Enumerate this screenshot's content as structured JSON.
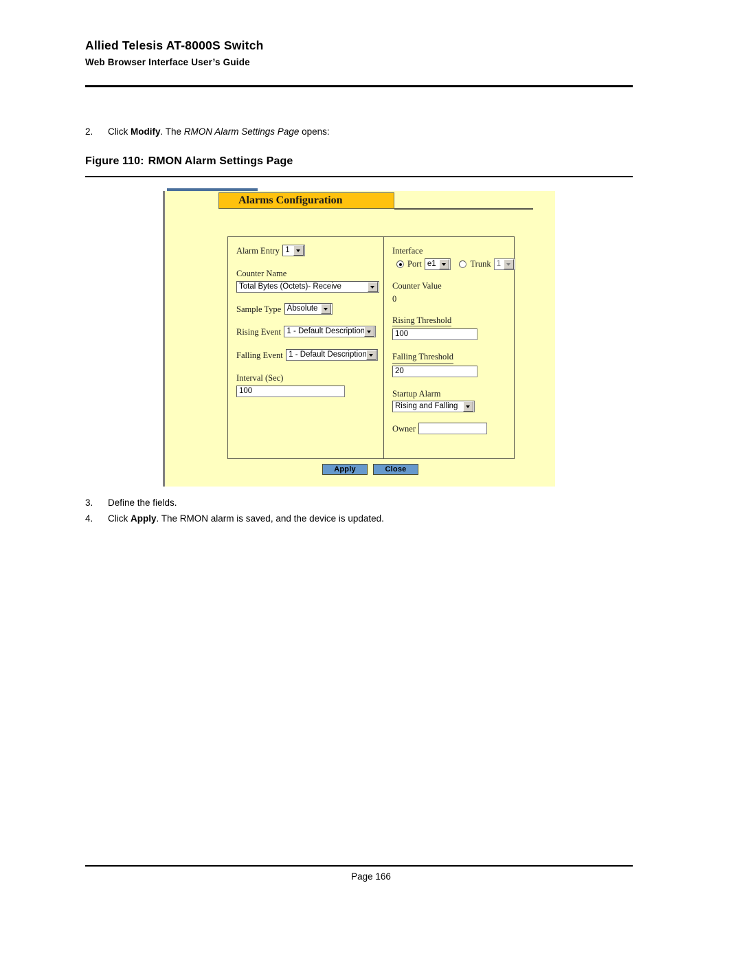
{
  "header": {
    "product_title": "Allied Telesis AT-8000S Switch",
    "guide_title": "Web Browser Interface User’s Guide"
  },
  "steps": {
    "step2": {
      "number": "2.",
      "prefix": "Click ",
      "bold": "Modify",
      "middle": ". The ",
      "italic": "RMON Alarm Settings Page",
      "suffix": " opens:"
    },
    "step3": {
      "number": "3.",
      "text": "Define the fields."
    },
    "step4": {
      "number": "4.",
      "prefix": "Click ",
      "bold": "Apply",
      "suffix": ". The RMON alarm is saved, and the device is updated."
    }
  },
  "figure": {
    "label": "Figure 110:",
    "title": "RMON Alarm Settings Page"
  },
  "screenshot": {
    "tab_title": "Alarms Configuration",
    "colors": {
      "panel_background": "#ffffc0",
      "tab_background": "#ffc20e",
      "button_background": "#6699cc",
      "blue_strip": "#4a6f9c",
      "border": "#55554a"
    },
    "left_column": [
      {
        "label": "Alarm Entry",
        "control": "select",
        "value": "1",
        "disabled": false
      },
      {
        "label": "Counter Name",
        "control": "select",
        "value": "Total Bytes (Octets)- Receive",
        "disabled": false
      },
      {
        "label": "Sample Type",
        "control": "select",
        "value": "Absolute",
        "disabled": false
      },
      {
        "label": "Rising Event",
        "control": "select",
        "value": "1 - Default Description",
        "disabled": false
      },
      {
        "label": "Falling Event",
        "control": "select",
        "value": "1 - Default Description",
        "disabled": false
      },
      {
        "label": "Interval (Sec)",
        "control": "text",
        "value": "100",
        "disabled": false
      }
    ],
    "right_column": {
      "interface": {
        "label": "Interface",
        "port_radio_label": "Port",
        "port_radio_selected": true,
        "port_value": "e1",
        "trunk_radio_label": "Trunk",
        "trunk_radio_selected": false,
        "trunk_value": "1",
        "trunk_disabled": true
      },
      "counter_value": {
        "label": "Counter Value",
        "value": "0"
      },
      "rising_threshold": {
        "label": "Rising Threshold",
        "value": "100"
      },
      "falling_threshold": {
        "label": "Falling Threshold",
        "value": "20"
      },
      "startup_alarm": {
        "label": "Startup Alarm",
        "value": "Rising and Falling"
      },
      "owner": {
        "label": "Owner",
        "value": ""
      }
    },
    "buttons": {
      "apply": "Apply",
      "close": "Close"
    }
  },
  "footer": {
    "page": "Page 166"
  }
}
